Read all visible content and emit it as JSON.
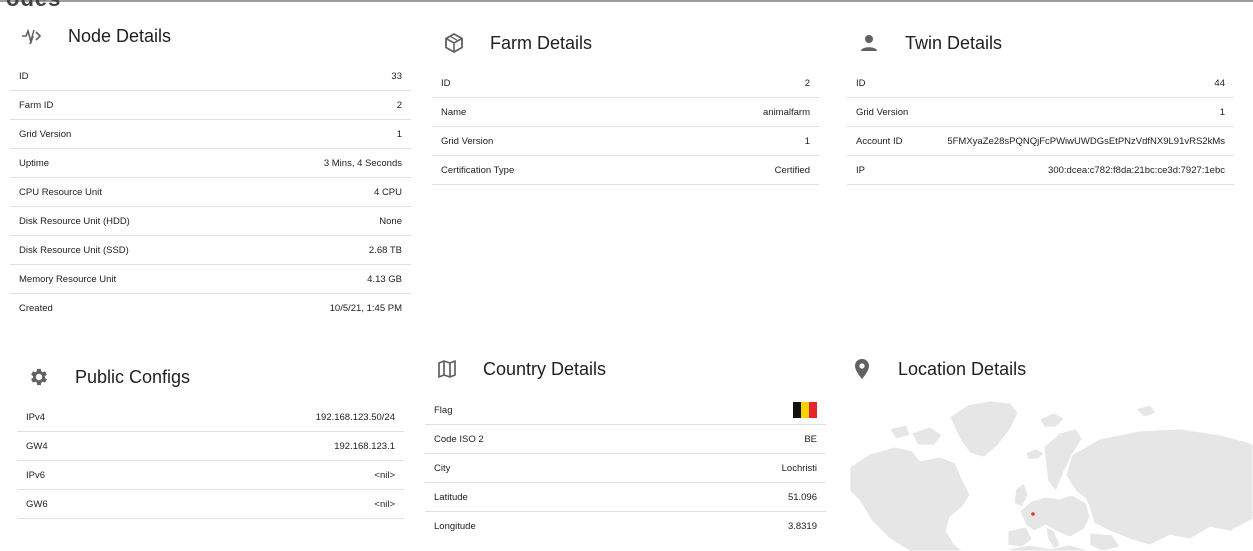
{
  "page": {
    "header_fragment": "odes"
  },
  "node_details": {
    "title": "Node Details",
    "icon": "pulse-icon",
    "rows": [
      {
        "label": "ID",
        "value": "33"
      },
      {
        "label": "Farm ID",
        "value": "2"
      },
      {
        "label": "Grid Version",
        "value": "1"
      },
      {
        "label": "Uptime",
        "value": "3 Mins, 4 Seconds"
      },
      {
        "label": "CPU Resource Unit",
        "value": "4 CPU"
      },
      {
        "label": "Disk Resource Unit (HDD)",
        "value": "None"
      },
      {
        "label": "Disk Resource Unit (SSD)",
        "value": "2.68 TB"
      },
      {
        "label": "Memory Resource Unit",
        "value": "4.13 GB"
      },
      {
        "label": "Created",
        "value": "10/5/21, 1:45 PM"
      }
    ]
  },
  "farm_details": {
    "title": "Farm Details",
    "icon": "cube-icon",
    "rows": [
      {
        "label": "ID",
        "value": "2"
      },
      {
        "label": "Name",
        "value": "animalfarm"
      },
      {
        "label": "Grid Version",
        "value": "1"
      },
      {
        "label": "Certification Type",
        "value": "Certified"
      }
    ]
  },
  "twin_details": {
    "title": "Twin Details",
    "icon": "person-icon",
    "rows": [
      {
        "label": "ID",
        "value": "44"
      },
      {
        "label": "Grid Version",
        "value": "1"
      },
      {
        "label": "Account ID",
        "value": "5FMXyaZe28sPQNQjFcPWiwUWDGsEtPNzVdfNX9L91vRS2kMs"
      },
      {
        "label": "IP",
        "value": "300:dcea:c782:f8da:21bc:ce3d:7927:1ebc"
      }
    ]
  },
  "public_configs": {
    "title": "Public Configs",
    "icon": "gear-icon",
    "rows": [
      {
        "label": "IPv4",
        "value": "192.168.123.50/24"
      },
      {
        "label": "GW4",
        "value": "192.168.123.1"
      },
      {
        "label": "IPv6",
        "value": "<nil>"
      },
      {
        "label": "GW6",
        "value": "<nil>"
      }
    ]
  },
  "country_details": {
    "title": "Country Details",
    "icon": "map-icon",
    "flag_colors": [
      "#111111",
      "#f5d300",
      "#e4252c"
    ],
    "rows": [
      {
        "label": "Flag",
        "value": ""
      },
      {
        "label": "Code ISO 2",
        "value": "BE"
      },
      {
        "label": "City",
        "value": "Lochristi"
      },
      {
        "label": "Latitude",
        "value": "51.096"
      },
      {
        "label": "Longitude",
        "value": "3.8319"
      }
    ]
  },
  "location_details": {
    "title": "Location Details",
    "icon": "location-pin-icon",
    "marker_color": "#e53935",
    "map_land_color": "#e6e6e6"
  }
}
